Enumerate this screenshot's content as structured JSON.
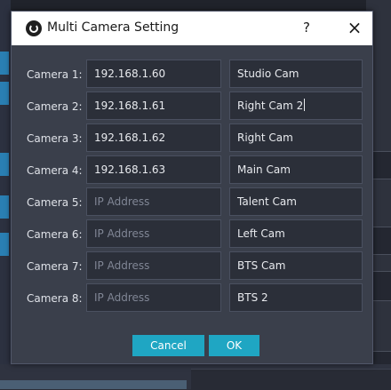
{
  "dialog": {
    "title": "Multi Camera Setting",
    "help_glyph": "?",
    "close_glyph": "×"
  },
  "cameras": [
    {
      "label": "Camera 1:",
      "ip": "192.168.1.60",
      "ip_placeholder": "IP Address",
      "name": "Studio Cam"
    },
    {
      "label": "Camera 2:",
      "ip": "192.168.1.61",
      "ip_placeholder": "IP Address",
      "name": "Right Cam 2"
    },
    {
      "label": "Camera 3:",
      "ip": "192.168.1.62",
      "ip_placeholder": "IP Address",
      "name": "Right Cam"
    },
    {
      "label": "Camera 4:",
      "ip": "192.168.1.63",
      "ip_placeholder": "IP Address",
      "name": "Main Cam"
    },
    {
      "label": "Camera 5:",
      "ip": "",
      "ip_placeholder": "IP Address",
      "name": "Talent Cam"
    },
    {
      "label": "Camera 6:",
      "ip": "",
      "ip_placeholder": "IP Address",
      "name": "Left Cam"
    },
    {
      "label": "Camera 7:",
      "ip": "",
      "ip_placeholder": "IP Address",
      "name": "BTS Cam"
    },
    {
      "label": "Camera 8:",
      "ip": "",
      "ip_placeholder": "IP Address",
      "name": "BTS 2"
    }
  ],
  "buttons": {
    "cancel_label": "Cancel",
    "ok_label": "OK"
  },
  "colors": {
    "accent": "#1fa6c3",
    "dialog_bg": "#3a3f4b",
    "field_bg": "#2b2f39"
  }
}
